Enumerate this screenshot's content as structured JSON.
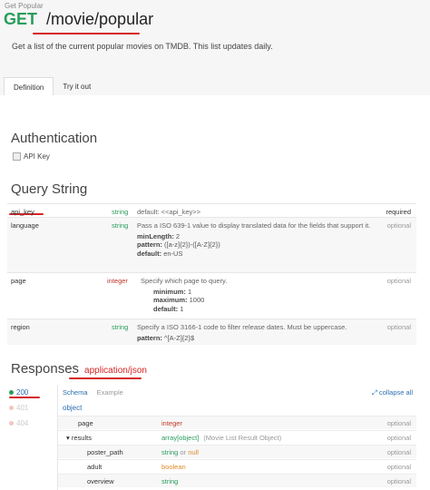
{
  "header": {
    "small_title": "Get Popular",
    "method": "GET",
    "path": "/movie/popular",
    "description": "Get a list of the current popular movies on TMDB. This list updates daily."
  },
  "tabs": [
    {
      "label": "Definition",
      "active": true
    },
    {
      "label": "Try it out",
      "active": false
    }
  ],
  "authentication": {
    "title": "Authentication",
    "item": "API Key"
  },
  "query": {
    "title": "Query String",
    "rows": [
      {
        "name": "api_key",
        "type": "string",
        "desc": "default: <<api_key>>",
        "status": "required"
      },
      {
        "name": "language",
        "type": "string",
        "desc": "Pass a ISO 639-1 value to display translated data for the fields that support it.",
        "kv": [
          {
            "k": "minLength:",
            "v": "2"
          },
          {
            "k": "pattern:",
            "v": "([a-z]{2})-([A-Z]{2})"
          },
          {
            "k": "default:",
            "v": "en-US"
          }
        ],
        "status": "optional"
      },
      {
        "name": "page",
        "type": "integer",
        "desc": "Specify which page to query.",
        "kv": [
          {
            "k": "minimum:",
            "v": "1"
          },
          {
            "k": "maximum:",
            "v": "1000"
          },
          {
            "k": "default:",
            "v": "1"
          }
        ],
        "status": "optional"
      },
      {
        "name": "region",
        "type": "string",
        "desc": "Specify a ISO 3166-1 code to filter release dates. Must be uppercase.",
        "kv": [
          {
            "k": "pattern:",
            "v": "^[A-Z]{2}$"
          }
        ],
        "status": "optional"
      }
    ]
  },
  "responses": {
    "title": "Responses",
    "content_type": "application/json",
    "codes": [
      "200",
      "401",
      "404"
    ],
    "schema_tab": "Schema",
    "example_tab": "Example",
    "collapse_all": "collapse all",
    "object_label": "object",
    "rows": [
      {
        "name": "page",
        "type": "integer",
        "status": "optional"
      },
      {
        "name": "results",
        "type": "array[object]",
        "note": "(Movie List Result Object)",
        "status": "optional"
      },
      {
        "name": "poster_path",
        "type": "string",
        "or": "or",
        "type2": "null",
        "status": "optional"
      },
      {
        "name": "adult",
        "type": "boolean",
        "status": "optional"
      },
      {
        "name": "overview",
        "type": "string",
        "status": "optional"
      }
    ]
  },
  "colors": {
    "method_green": "#2a9d5c",
    "accent_red": "#d62424",
    "link_blue": "#2a6fb0"
  }
}
